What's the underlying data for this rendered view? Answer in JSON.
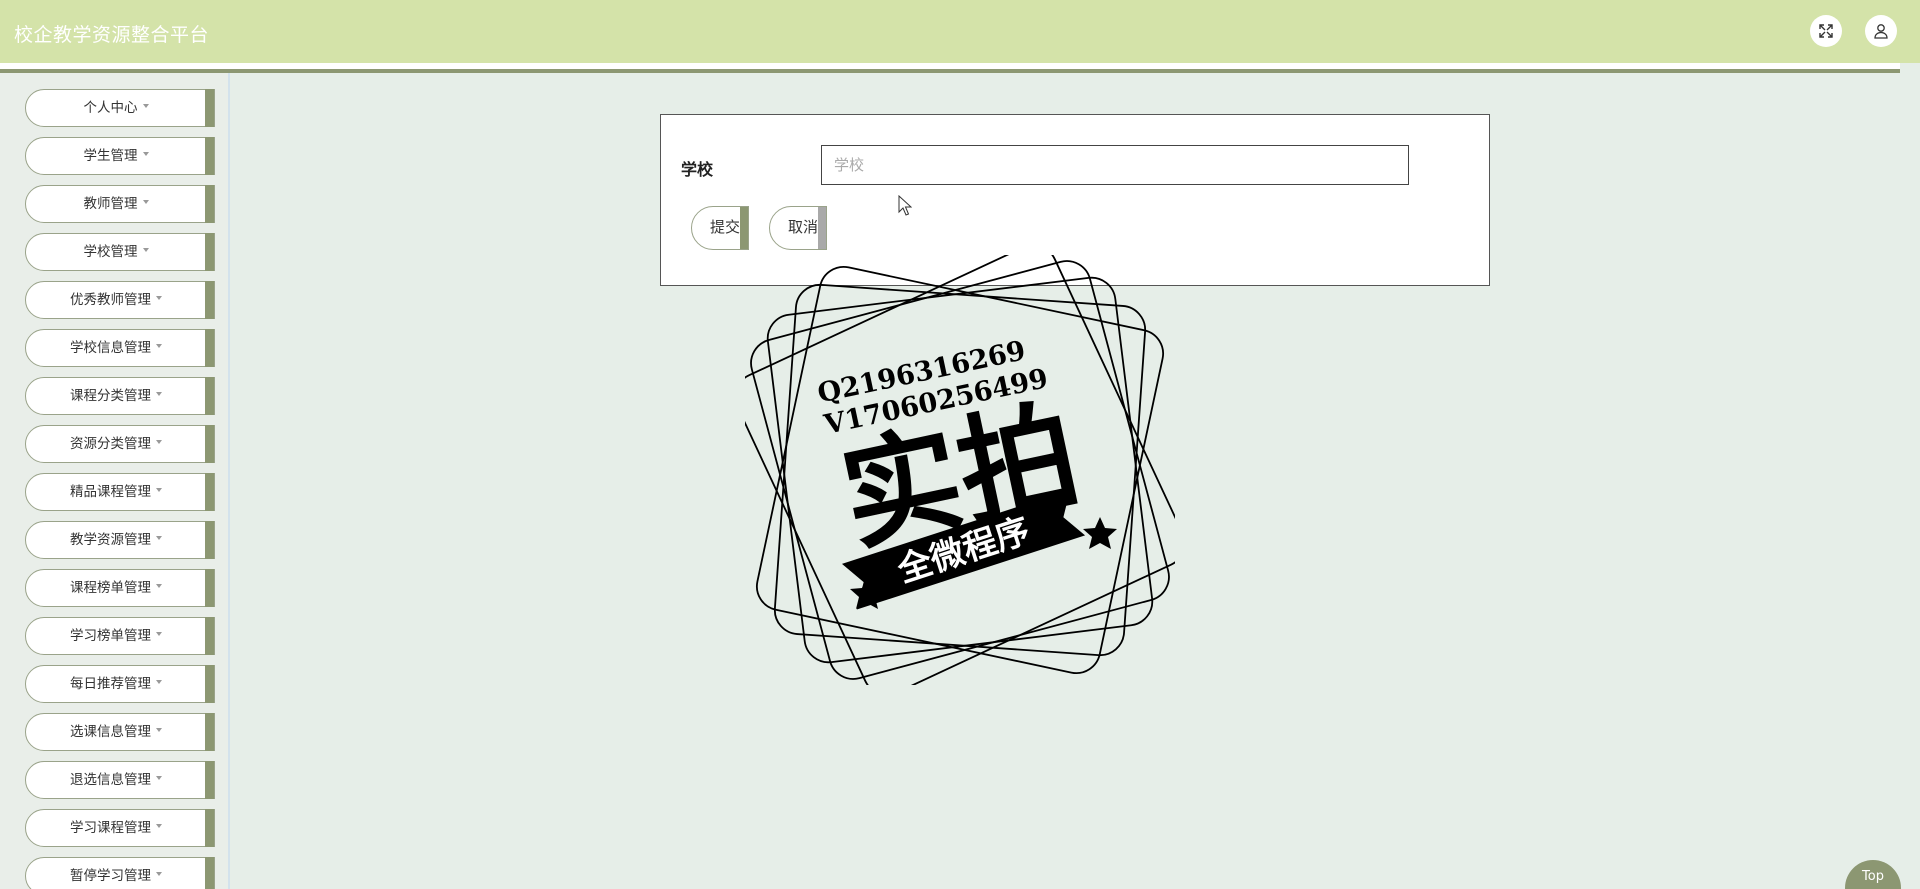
{
  "header": {
    "title": "校企教学资源整合平台",
    "fullscreen_icon": "fullscreen-icon",
    "user_icon": "user-icon"
  },
  "sidebar": {
    "items": [
      {
        "label": "个人中心"
      },
      {
        "label": "学生管理"
      },
      {
        "label": "教师管理"
      },
      {
        "label": "学校管理"
      },
      {
        "label": "优秀教师管理"
      },
      {
        "label": "学校信息管理"
      },
      {
        "label": "课程分类管理"
      },
      {
        "label": "资源分类管理"
      },
      {
        "label": "精品课程管理"
      },
      {
        "label": "教学资源管理"
      },
      {
        "label": "课程榜单管理"
      },
      {
        "label": "学习榜单管理"
      },
      {
        "label": "每日推荐管理"
      },
      {
        "label": "选课信息管理"
      },
      {
        "label": "退选信息管理"
      },
      {
        "label": "学习课程管理"
      },
      {
        "label": "暂停学习管理"
      }
    ]
  },
  "form": {
    "school_label": "学校",
    "school_placeholder": "学校",
    "school_value": "",
    "submit_label": "提交",
    "cancel_label": "取消"
  },
  "watermark": {
    "line1": "Q2196316269",
    "line2": "V17060256499",
    "main": "实拍",
    "banner": "全微程序"
  },
  "top_button": {
    "label": "Top"
  }
}
